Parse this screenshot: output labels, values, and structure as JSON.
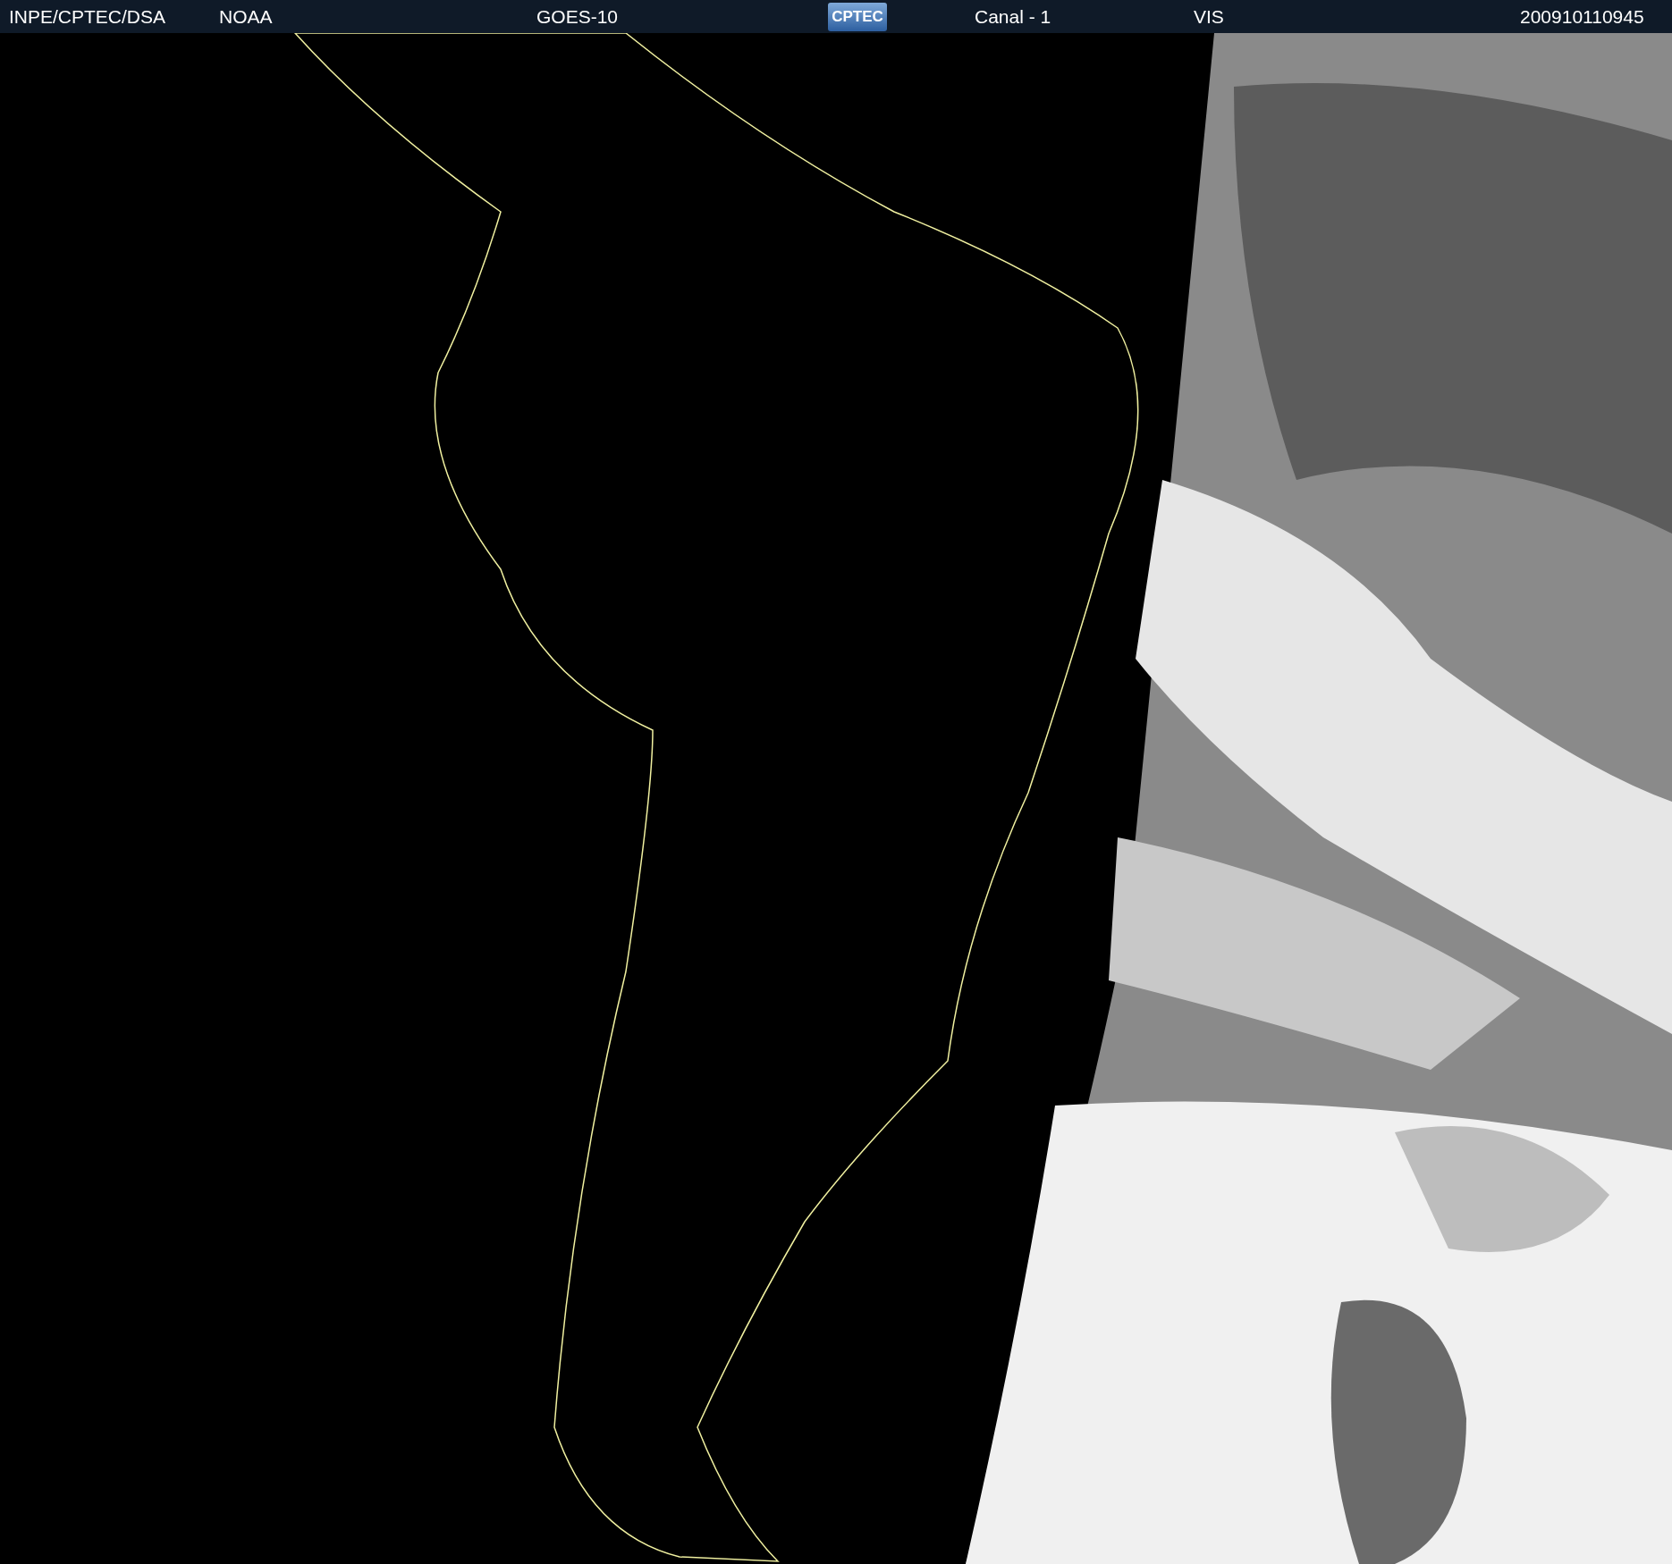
{
  "header": {
    "source": "INPE/CPTEC/DSA",
    "agency": "NOAA",
    "satellite": "GOES-10",
    "logo": "CPTEC",
    "channel": "Canal - 1",
    "band": "VIS",
    "timestamp": "200910110945"
  }
}
